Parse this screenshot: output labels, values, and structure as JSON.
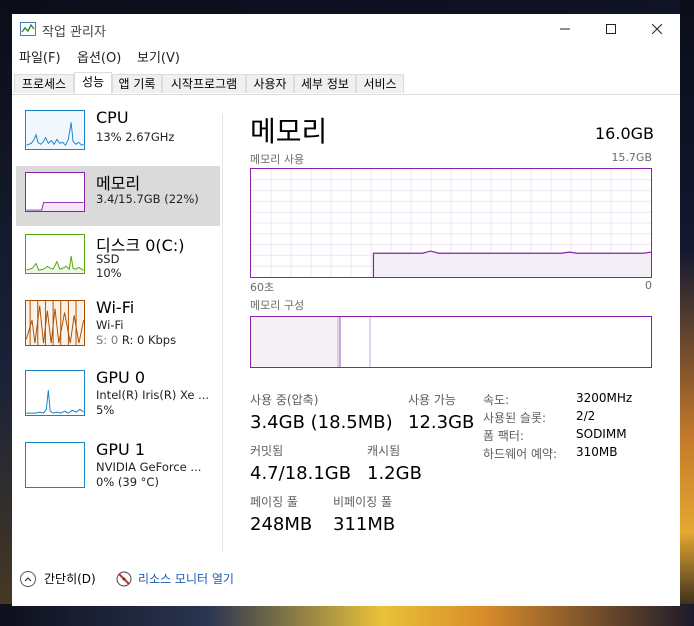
{
  "window": {
    "title": "작업 관리자"
  },
  "menu": {
    "file": "파일(F)",
    "options": "옵션(O)",
    "view": "보기(V)"
  },
  "tabs": [
    "프로세스",
    "성능",
    "앱 기록",
    "시작프로그램",
    "사용자",
    "세부 정보",
    "서비스"
  ],
  "sidebar": {
    "cpu": {
      "title": "CPU",
      "line1": "13% 2.67GHz"
    },
    "memory": {
      "title": "메모리",
      "line1": "3.4/15.7GB (22%)"
    },
    "disk": {
      "title": "디스크 0(C:)",
      "line1": "SSD",
      "line2": "10%"
    },
    "wifi": {
      "title": "Wi-Fi",
      "line1": "Wi-Fi",
      "line2_s": "S: 0",
      "line2_r": "R: 0 Kbps"
    },
    "gpu0": {
      "title": "GPU 0",
      "line1": "Intel(R) Iris(R) Xe ...",
      "line2": "5%"
    },
    "gpu1": {
      "title": "GPU 1",
      "line1": "NVIDIA GeForce ...",
      "line2": "0% (39 °C)"
    }
  },
  "main": {
    "title": "메모리",
    "total": "16.0GB",
    "usage_label": "메모리 사용",
    "usage_max": "15.7GB",
    "axis_left": "60초",
    "axis_right": "0",
    "composition_label": "메모리 구성",
    "chart_usage_fraction": [
      0,
      0,
      0,
      0,
      0,
      0,
      0,
      0,
      0,
      0,
      0,
      0,
      0,
      0,
      0,
      0.22,
      0.22,
      0.22,
      0.22,
      0.22,
      0.22,
      0.22,
      0.24,
      0.22,
      0.22,
      0.22,
      0.22,
      0.22,
      0.22,
      0.22,
      0.22,
      0.22,
      0.22,
      0.22,
      0.22,
      0.22,
      0.22,
      0.22,
      0.22,
      0.23,
      0.22,
      0.22,
      0.22,
      0.22,
      0.22,
      0.22,
      0.22,
      0.22,
      0.22,
      0.23
    ],
    "in_use_label": "사용 중(압축)",
    "in_use_value": "3.4GB (18.5MB)",
    "available_label": "사용 가능",
    "available_value": "12.3GB",
    "committed_label": "커밋됨",
    "committed_value": "4.7/18.1GB",
    "cached_label": "캐시됨",
    "cached_value": "1.2GB",
    "paged_label": "페이징 풀",
    "paged_value": "248MB",
    "nonpaged_label": "비페이징 풀",
    "nonpaged_value": "311MB",
    "speed_label": "속도:",
    "speed_value": "3200MHz",
    "slots_label": "사용된 슬롯:",
    "slots_value": "2/2",
    "form_label": "폼 팩터:",
    "form_value": "SODIMM",
    "reserved_label": "하드웨어 예약:",
    "reserved_value": "310MB"
  },
  "footer": {
    "less_details": "간단히(D)",
    "resource_monitor": "리소스 모니터 열기"
  },
  "colors": {
    "memory_accent": "#8b1fa8",
    "cpu_accent": "#1782c4",
    "disk_accent": "#4da60c",
    "wifi_accent": "#a74f01"
  }
}
